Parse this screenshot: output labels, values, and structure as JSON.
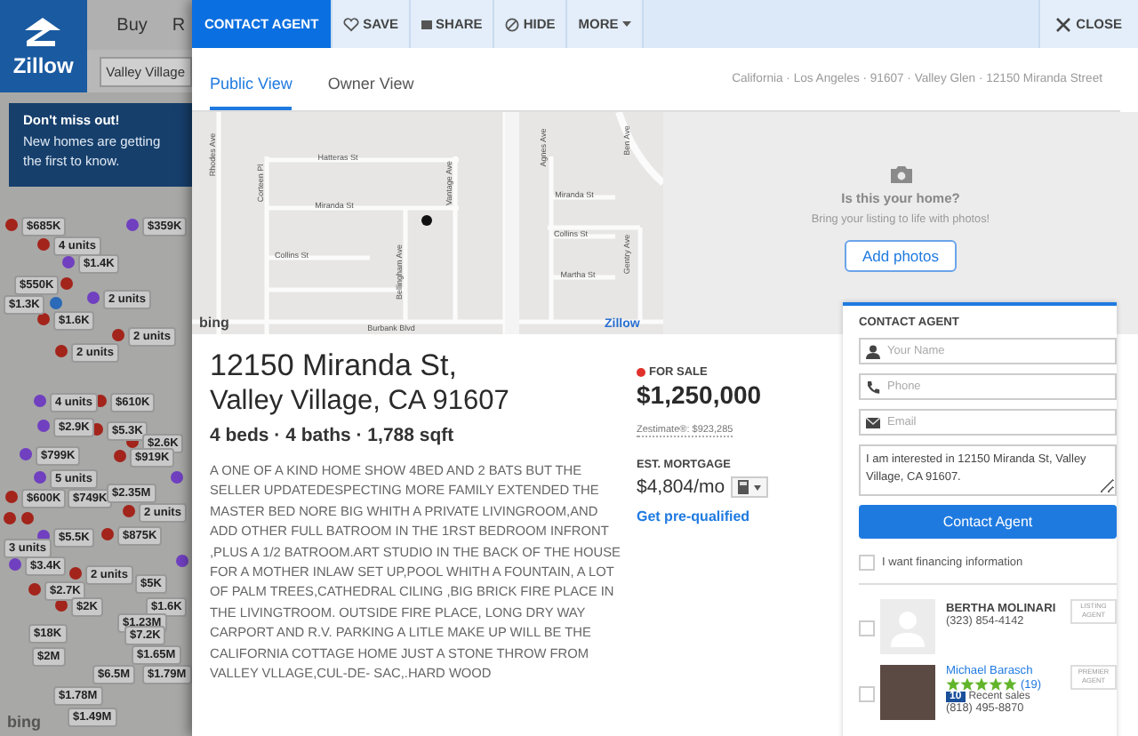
{
  "sidebar": {
    "logo": "Zillow",
    "nav": [
      {
        "label": "Buy"
      },
      {
        "label": "R"
      }
    ],
    "search": {
      "value": "Valley Village"
    },
    "banner": {
      "title": "Don't miss out!",
      "lines": [
        "New homes are getting",
        "the first to know."
      ]
    },
    "map": {
      "labels": [
        "$685K",
        "$359K",
        "4 units",
        "$1.4K",
        "$550K",
        "$1.3K",
        "$1.6K",
        "2 units",
        "2 units",
        "2 units",
        "4 units",
        "$610K",
        "$2.9K",
        "$5.3K",
        "$2.6K",
        "$799K",
        "$919K",
        "5 units",
        "$600K",
        "$749K",
        "$2.35M",
        "2 units",
        "$5.5K",
        "$875K",
        "3 units",
        "$3.4K",
        "2 units",
        "$2.7K",
        "$5K",
        "$2K",
        "$1.6K",
        "$1.23M",
        "$18K",
        "$2M",
        "$7.2K",
        "$1.65M",
        "$6.5M",
        "$1.79M",
        "$1.78M",
        "$1.49M"
      ],
      "pins": [
        {
          "color": "#a3241b"
        },
        {
          "color": "#7040c0"
        },
        {
          "color": "#a3241b"
        },
        {
          "color": "#7040c0"
        },
        {
          "color": "#a3241b"
        },
        {
          "color": "#2a6ab8"
        },
        {
          "color": "#a3241b"
        },
        {
          "color": "#7040c0"
        },
        {
          "color": "#a3241b"
        },
        {
          "color": "#a3241b"
        },
        {
          "color": "#7040c0"
        },
        {
          "color": "#a3241b"
        },
        {
          "color": "#7040c0"
        },
        {
          "color": "#a3241b"
        },
        {
          "color": "#a3241b"
        },
        {
          "color": "#7040c0"
        },
        {
          "color": "#a3241b"
        },
        {
          "color": "#7040c0"
        },
        {
          "color": "#a3241b"
        },
        {
          "color": "#a3241b"
        },
        {
          "color": "#7040c0"
        },
        {
          "color": "#a3241b"
        },
        {
          "color": "#7040c0"
        },
        {
          "color": "#a3241b"
        },
        {
          "color": "#a3241b"
        },
        {
          "color": "#7040c0"
        },
        {
          "color": "#a3241b"
        },
        {
          "color": "#a3241b"
        },
        {
          "color": "#7040c0"
        },
        {
          "color": "#a3241b"
        }
      ],
      "attribution": "bing"
    }
  },
  "toolbar": {
    "buttons": [
      {
        "label": "CONTACT AGENT",
        "kind": "primary"
      },
      {
        "label": "SAVE",
        "kind": "heart"
      },
      {
        "label": "SHARE",
        "kind": "share"
      },
      {
        "label": "HIDE",
        "kind": "hide"
      },
      {
        "label": "MORE",
        "kind": "more"
      }
    ],
    "close": "CLOSE"
  },
  "tabs": [
    {
      "label": "Public View",
      "selected": true
    },
    {
      "label": "Owner View",
      "selected": false
    }
  ],
  "breadcrumb": "California · Los Angeles · 91607 · Valley Glen · 12150 Miranda Street",
  "street_map": {
    "streets": [
      "Rhodes Ave",
      "Hatteras St",
      "Miranda St",
      "Collins St",
      "Corteen Pl",
      "Bellingham Ave",
      "Vantage Ave",
      "Burbank Blvd",
      "Agnes Ave",
      "Miranda St",
      "Collins St",
      "Martha St",
      "Ben Ave",
      "Gentry Ave"
    ],
    "attribution": "bing",
    "logo": "Zillow"
  },
  "photos": {
    "title": "Is this your home?",
    "subtitle": "Bring your listing to life with photos!",
    "button": "Add photos"
  },
  "listing": {
    "address_line1": "12150 Miranda St,",
    "address_line2": "Valley Village, CA 91607",
    "facts": "4 beds · 4 baths · 1,788 sqft",
    "description": "A ONE OF A KIND HOME SHOW 4BED AND 2 BATS BUT THE SELLER UPDATEDESPECTING MORE FAMILY EXTENDED THE MASTER BED NORE BIG WHITH A PRIVATE LIVINGROOM,AND ADD OTHER FULL BATROOM IN THE 1RST BEDROOM INFRONT ,PLUS A 1/2 BATROOM.ART STUDIO IN THE BACK OF THE HOUSE FOR A MOTHER INLAW SET UP,POOL WHITH A FOUNTAIN, A LOT OF PALM TREES,CATHEDRAL CILING ,BIG BRICK FIRE PLACE IN THE LIVINGTROOM. OUTSIDE FIRE PLACE, LONG DRY WAY CARPORT AND R.V. PARKING A LITLE MAKE UP WILL BE THE CALIFORNIA COTTAGE HOME JUST A STONE THROW FROM VALLEY VLLAGE,CUL-DE- SAC,.HARD WOOD",
    "status": "FOR SALE",
    "price": "$1,250,000",
    "zestimate": "Zestimate®: $923,285",
    "mortgage_label": "EST. MORTGAGE",
    "mortgage": "$4,804/mo",
    "prequalify": "Get pre-qualified"
  },
  "contact": {
    "title": "CONTACT AGENT",
    "fields": [
      {
        "placeholder": "Your Name",
        "kind": "person"
      },
      {
        "placeholder": "Phone",
        "kind": "phone"
      },
      {
        "placeholder": "Email",
        "kind": "email"
      }
    ],
    "message": "I am interested in 12150 Miranda St, Valley Village, CA 91607.",
    "button": "Contact Agent",
    "financing": {
      "label": "I want financing information",
      "checked": false
    },
    "agents": [
      {
        "kind": "listing",
        "name": "BERTHA MOLINARI",
        "phone": "(323) 854-4142",
        "badge": "LISTING AGENT",
        "checked": false
      },
      {
        "kind": "premier",
        "name": "Michael Barasch",
        "stars": 5,
        "reviews": "(19)",
        "sales_count": "10",
        "sales_label": "Recent sales",
        "phone": "(818) 495-8870",
        "badge": "PREMIER AGENT",
        "checked": false
      }
    ]
  }
}
